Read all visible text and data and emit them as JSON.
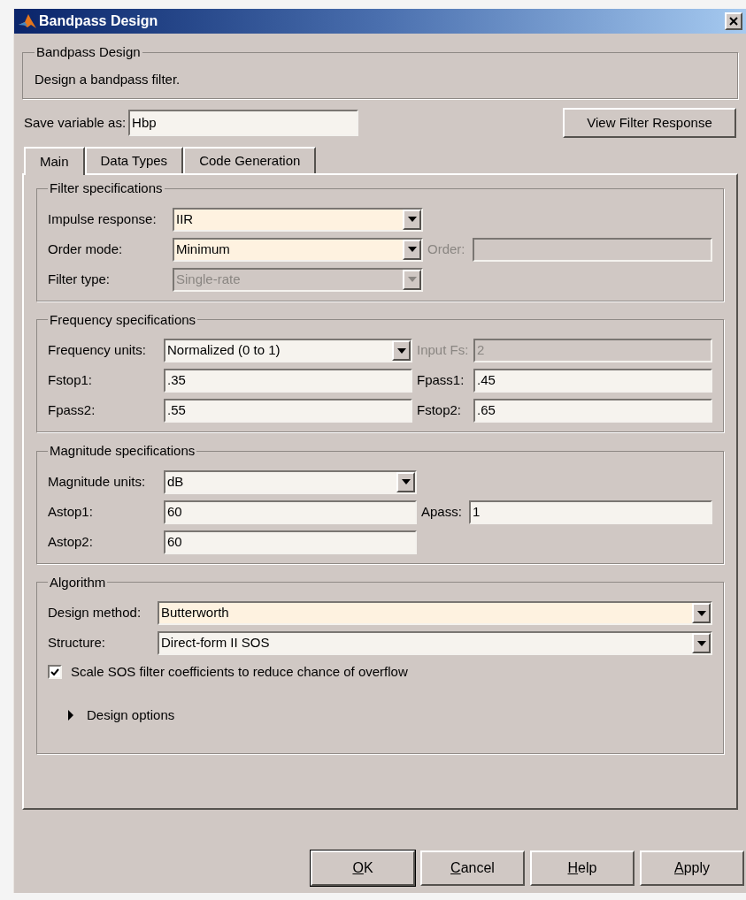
{
  "window": {
    "title": "Bandpass Design"
  },
  "description_group": {
    "title": "Bandpass Design",
    "text": "Design a bandpass filter."
  },
  "save_variable": {
    "label": "Save variable as:",
    "value": "Hbp"
  },
  "view_button": "View Filter Response",
  "tabs": [
    {
      "label": "Main",
      "selected": true
    },
    {
      "label": "Data Types",
      "selected": false
    },
    {
      "label": "Code Generation",
      "selected": false
    }
  ],
  "sections": [
    {
      "kind": "filter",
      "title": "Filter specifications",
      "rows": [
        {
          "label": "Impulse response:",
          "control": {
            "kind": "dropdown",
            "value": "IIR",
            "highlighted": true,
            "disabled": false
          }
        },
        {
          "label": "Order mode:",
          "control": {
            "kind": "dropdown",
            "value": "Minimum",
            "highlighted": true,
            "disabled": false
          },
          "right": {
            "label": "Order:",
            "disabled": true,
            "control": {
              "kind": "input",
              "disabled": true,
              "highlighted": false
            }
          }
        },
        {
          "label": "Filter type:",
          "control": {
            "kind": "dropdown",
            "value": "Single-rate",
            "highlighted": false,
            "disabled": true
          }
        }
      ]
    },
    {
      "kind": "frequency",
      "title": "Frequency specifications",
      "rows": [
        {
          "label": "Frequency units:",
          "control": {
            "kind": "dropdown",
            "value": "Normalized (0 to 1)",
            "highlighted": false,
            "disabled": false
          },
          "right": {
            "label": "Input Fs:",
            "disabled": true,
            "control": {
              "kind": "input",
              "value": "2",
              "disabled": true,
              "highlighted": false
            }
          }
        },
        {
          "label": "Fstop1:",
          "control": {
            "kind": "input",
            "value": ".35",
            "highlighted": false,
            "disabled": false
          },
          "right": {
            "label": "Fpass1:",
            "disabled": false,
            "control": {
              "kind": "input",
              "value": ".45",
              "disabled": false,
              "highlighted": false
            }
          }
        },
        {
          "label": "Fpass2:",
          "control": {
            "kind": "input",
            "value": ".55",
            "highlighted": false,
            "disabled": false
          },
          "right": {
            "label": "Fstop2:",
            "disabled": false,
            "control": {
              "kind": "input",
              "value": ".65",
              "disabled": false,
              "highlighted": false
            }
          }
        }
      ]
    },
    {
      "kind": "magnitude",
      "title": "Magnitude specifications",
      "rows": [
        {
          "label": "Magnitude units:",
          "control": {
            "kind": "dropdown",
            "value": "dB",
            "highlighted": false,
            "disabled": false
          }
        },
        {
          "label": "Astop1:",
          "control": {
            "kind": "input",
            "value": "60",
            "highlighted": false,
            "disabled": false
          },
          "right": {
            "label": "Apass:",
            "disabled": false,
            "control": {
              "kind": "input",
              "value": "1",
              "disabled": false,
              "highlighted": false
            }
          }
        },
        {
          "label": "Astop2:",
          "control": {
            "kind": "input",
            "value": "60",
            "highlighted": false,
            "disabled": false
          }
        }
      ]
    },
    {
      "kind": "algorithm",
      "title": "Algorithm",
      "rows": [
        {
          "label": "Design method:",
          "control": {
            "kind": "dropdown",
            "value": "Butterworth",
            "highlighted": true,
            "disabled": false
          }
        },
        {
          "label": "Structure:",
          "control": {
            "kind": "dropdown",
            "value": "Direct-form II SOS",
            "highlighted": false,
            "disabled": false
          }
        }
      ],
      "checkbox": {
        "label": "Scale SOS filter coefficients to reduce chance of overflow",
        "checked": true
      },
      "design_options": {
        "label": "Design options",
        "expanded": false
      }
    }
  ],
  "buttons": [
    {
      "label": "OK",
      "default": true
    },
    {
      "label": "Cancel",
      "default": false
    },
    {
      "label": "Help",
      "default": false
    },
    {
      "label": "Apply",
      "default": false
    }
  ]
}
